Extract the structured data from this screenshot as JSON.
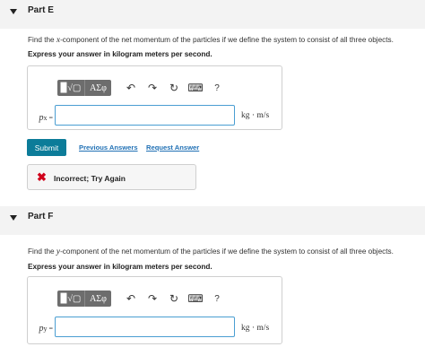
{
  "part_e": {
    "title": "Part E",
    "question_before": "Find the ",
    "question_var": "x",
    "question_after": "-component of the net momentum of the particles if we define the system to consist of all three objects.",
    "instruction": "Express your answer in kilogram meters per second.",
    "toolbar": {
      "templates": "▉√▢",
      "greek": "ΑΣφ",
      "help": "?"
    },
    "label_var": "p",
    "label_sub": "x",
    "label_eq": " =",
    "input_value": "",
    "unit": "kg · m/s",
    "submit_label": "Submit",
    "previous_answers": "Previous Answers",
    "request_answer": "Request Answer",
    "feedback": "Incorrect; Try Again"
  },
  "part_f": {
    "title": "Part F",
    "question_before": "Find the ",
    "question_var": "y",
    "question_after": "-component of the net momentum of the particles if we define the system to consist of all three objects.",
    "instruction": "Express your answer in kilogram meters per second.",
    "toolbar": {
      "templates": "▉√▢",
      "greek": "ΑΣφ",
      "help": "?"
    },
    "label_var": "p",
    "label_sub": "y",
    "label_eq": " =",
    "input_value": "",
    "unit": "kg · m/s"
  },
  "icons": [
    "collapse-triangle-icon",
    "undo-icon",
    "redo-icon",
    "reset-icon",
    "keyboard-icon",
    "help-icon",
    "incorrect-x-icon"
  ],
  "colors": {
    "submit": "#0c7c99",
    "link": "#2171b5",
    "error": "#d0021b",
    "input_border": "#4a9ed2"
  }
}
